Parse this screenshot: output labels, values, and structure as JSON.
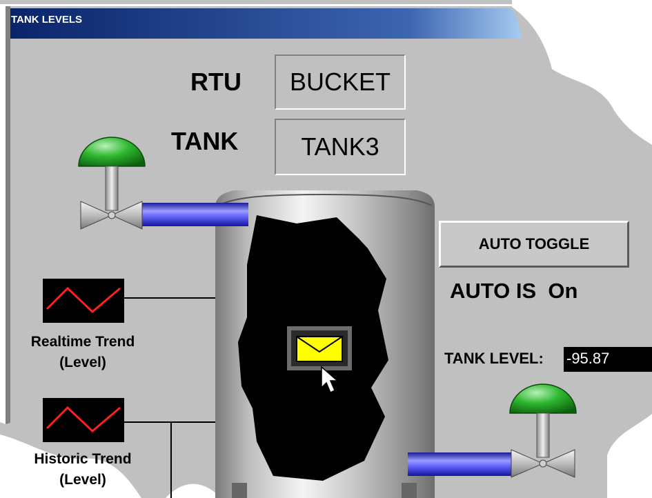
{
  "window": {
    "title": "TANK LEVELS"
  },
  "labels": {
    "rtu": "RTU",
    "tank": "TANK",
    "tank_level": "TANK LEVEL:"
  },
  "fields": {
    "rtu_value": "BUCKET",
    "tank_value": "TANK3",
    "tank_level_value": "-95.87"
  },
  "auto": {
    "button_label": "AUTO TOGGLE",
    "status": "AUTO IS  On"
  },
  "trends": {
    "realtime": {
      "line1": "Realtime Trend",
      "line2": "(Level)"
    },
    "historic": {
      "line1": "Historic Trend",
      "line2": "(Level)"
    }
  },
  "icons": [
    "valve-icon",
    "trend-icon",
    "envelope-icon",
    "cursor-icon"
  ],
  "colors": {
    "titlebar": "#0a246a",
    "panel": "#c0c0c0",
    "pipe": "#3b3bf0",
    "valve_cap": "#1f9a1f",
    "envelope": "#ffff00"
  }
}
